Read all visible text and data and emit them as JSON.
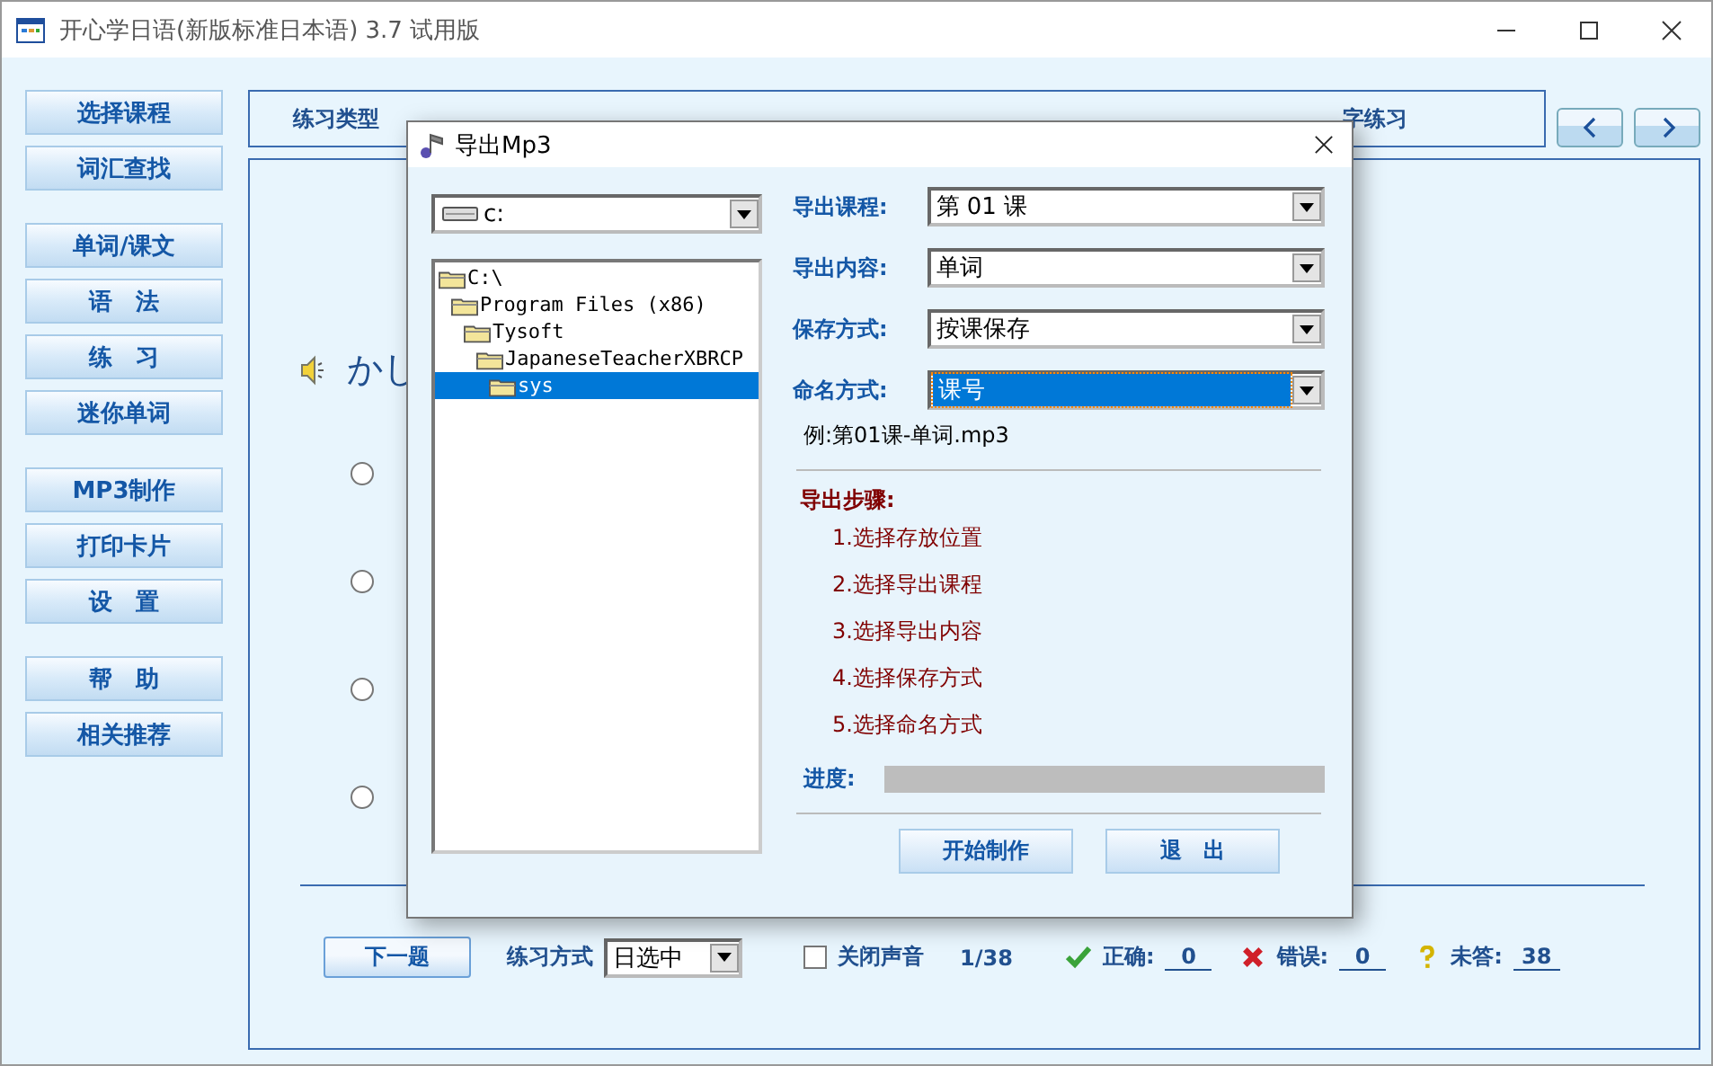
{
  "window": {
    "title": "开心学日语(新版标准日本语) 3.7 试用版"
  },
  "sidebar": {
    "groups": [
      [
        "选择课程",
        "词汇查找"
      ],
      [
        "单词/课文",
        "语　法",
        "练　习",
        "迷你单词"
      ],
      [
        "MP3制作",
        "打印卡片",
        "设　置"
      ],
      [
        "帮　助",
        "相关推荐"
      ]
    ]
  },
  "practice": {
    "type_label": "练习类型",
    "visible_option": "字练习",
    "word": "かし",
    "answers": [
      {
        "selected": false
      },
      {
        "selected": false
      },
      {
        "selected": false
      },
      {
        "selected": false
      }
    ],
    "next_button": "下一题",
    "mode_label": "练习方式",
    "mode_value": "日选中",
    "mute": {
      "label": "关闭声音",
      "checked": false
    },
    "progress": "1/38",
    "stats": [
      {
        "kind": "correct",
        "label": "正确:",
        "value": "0"
      },
      {
        "kind": "wrong",
        "label": "错误:",
        "value": "0"
      },
      {
        "kind": "unanswered",
        "label": "未答:",
        "value": "38"
      }
    ]
  },
  "dialog": {
    "title": "导出Mp3",
    "drive": "c:",
    "tree": [
      {
        "label": "C:\\",
        "selected": false,
        "children": [
          {
            "label": "Program Files (x86)",
            "selected": false,
            "children": [
              {
                "label": "Tysoft",
                "selected": false,
                "children": [
                  {
                    "label": "JapaneseTeacherXBRCP",
                    "selected": false,
                    "children": [
                      {
                        "label": "sys",
                        "selected": true
                      }
                    ]
                  }
                ]
              }
            ]
          }
        ]
      }
    ],
    "fields": [
      {
        "label": "导出课程:",
        "value": "第 01 课",
        "focused": false
      },
      {
        "label": "导出内容:",
        "value": "单词",
        "focused": false
      },
      {
        "label": "保存方式:",
        "value": "按课保存",
        "focused": false
      },
      {
        "label": "命名方式:",
        "value": "课号",
        "focused": true
      }
    ],
    "example": "例:第01课-单词.mp3",
    "steps_title": "导出步骤:",
    "steps": [
      "1.选择存放位置",
      "2.选择导出课程",
      "3.选择导出内容",
      "4.选择保存方式",
      "5.选择命名方式"
    ],
    "progress": {
      "label": "进度:",
      "level": 0
    },
    "buttons": [
      "开始制作",
      "退　出"
    ]
  }
}
